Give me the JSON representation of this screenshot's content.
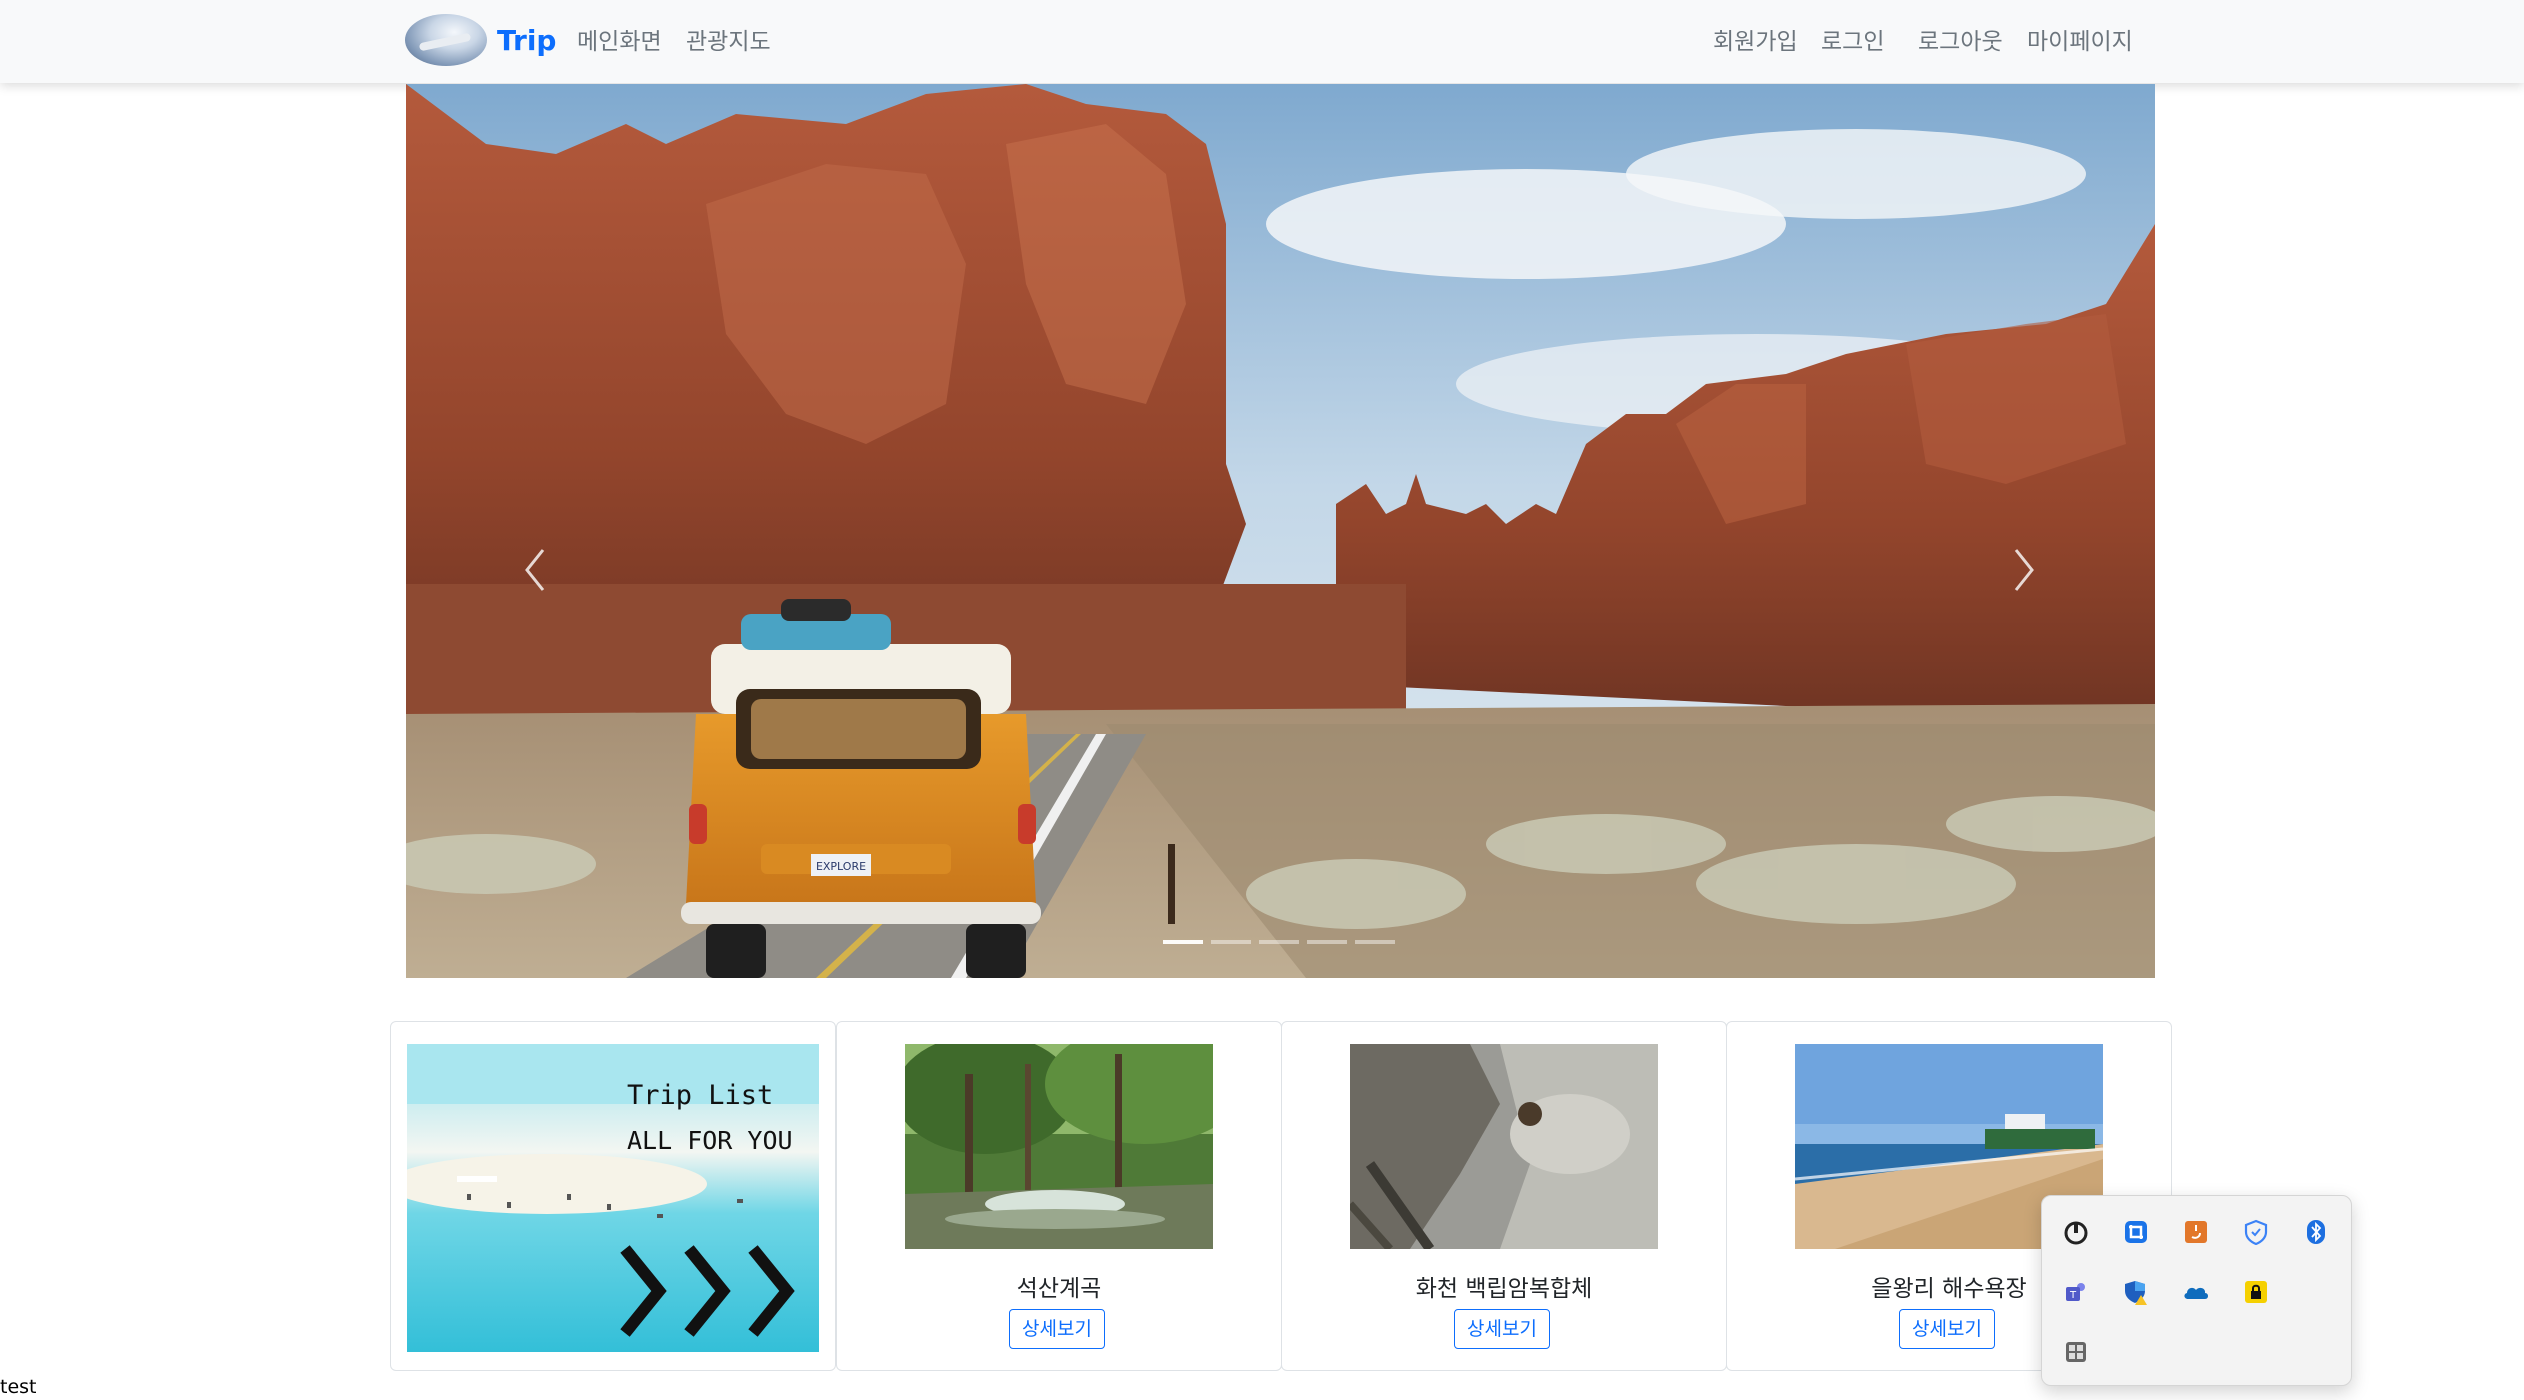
{
  "navbar": {
    "brand": "Trip",
    "links_left": [
      "메인화면",
      "관광지도"
    ],
    "links_right": [
      "회원가입",
      "로그인",
      "로그아웃",
      "마이페이지"
    ]
  },
  "carousel": {
    "prev_icon": "chevron-left-icon",
    "next_icon": "chevron-right-icon",
    "plate_text": "EXPLORE",
    "indicator_count": 5,
    "active_index": 0
  },
  "promo": {
    "line1": "Trip List",
    "line2": "ALL FOR YOU"
  },
  "cards": [
    {
      "title": "석산계곡",
      "button": "상세보기"
    },
    {
      "title": "화천 백립암복합체",
      "button": "상세보기"
    },
    {
      "title": "을왕리 해수욕장",
      "button": "상세보기"
    }
  ],
  "footer": {
    "text": "test"
  },
  "tray": {
    "icons": [
      "power-icon",
      "snip-icon",
      "java-icon",
      "shield-icon",
      "bluetooth-icon",
      "teams-icon",
      "defender-icon",
      "onedrive-icon",
      "lock-icon",
      "grid-icon"
    ]
  },
  "colors": {
    "accent": "#0d6efd",
    "navbar_bg": "#f8f9fa",
    "link": "#6c757d"
  }
}
